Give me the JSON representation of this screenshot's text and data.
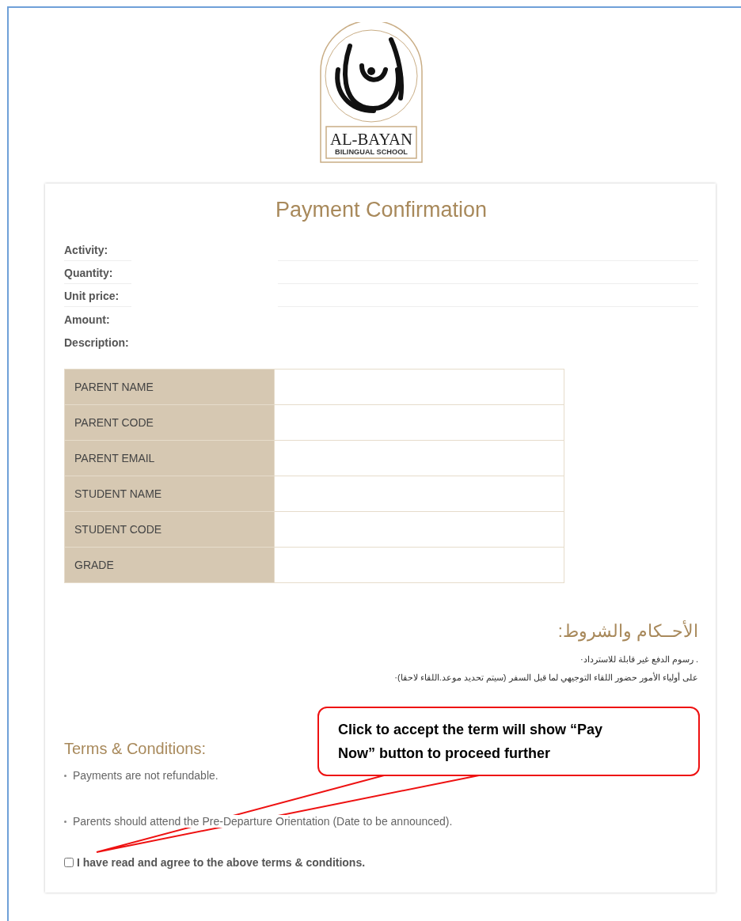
{
  "logo": {
    "name": "AL-BAYAN",
    "subtitle": "BILINGUAL SCHOOL"
  },
  "title": "Payment Confirmation",
  "details": [
    {
      "label": "Activity:",
      "ruled": true
    },
    {
      "label": "Quantity:",
      "ruled": true
    },
    {
      "label": "Unit price:",
      "ruled": true
    },
    {
      "label": "Amount:",
      "ruled": false
    },
    {
      "label": "Description:",
      "ruled": false
    }
  ],
  "info_table": {
    "rows": [
      {
        "label": "PARENT NAME"
      },
      {
        "label": "PARENT CODE"
      },
      {
        "label": "PARENT EMAIL"
      },
      {
        "label": "STUDENT NAME"
      },
      {
        "label": "STUDENT CODE"
      },
      {
        "label": "GRADE"
      }
    ]
  },
  "terms_arabic": {
    "heading": "الأحــكام والشروط:",
    "items": [
      ".  رسوم الدفع غير قابلة للاسترداد·",
      "على أولياء الأمور حضور اللقاء التوجيهي لما قبل السفر (سيتم تحديد موعد.اللقاء لاحقا)·"
    ]
  },
  "terms_english": {
    "heading": "Terms & Conditions:",
    "items": [
      "Payments are not refundable.",
      "Parents should attend the Pre-Departure Orientation (Date to be announced)."
    ]
  },
  "agree": {
    "label": "I have read and agree to the above terms & conditions.",
    "checked": false
  },
  "callout": {
    "text": "Click to accept the term will show “Pay Now” button to proceed further"
  }
}
